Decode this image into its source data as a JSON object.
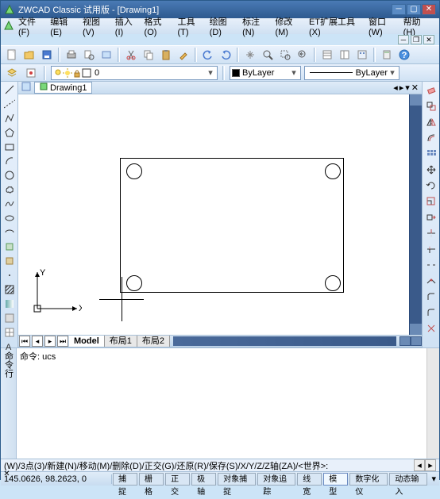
{
  "title": "ZWCAD Classic 试用版 - [Drawing1]",
  "menus": [
    "文件(F)",
    "编辑(E)",
    "视图(V)",
    "插入(I)",
    "格式(O)",
    "工具(T)",
    "绘图(D)",
    "标注(N)",
    "修改(M)",
    "ET扩展工具(X)",
    "窗口(W)",
    "帮助(H)"
  ],
  "doc_tab": "Drawing1",
  "layer_name": "0",
  "property": {
    "color_text": "ByLayer",
    "linetype_text": "ByLayer"
  },
  "model_tabs": {
    "active": "Model",
    "others": [
      "布局1",
      "布局2"
    ]
  },
  "cmd_line": "(W)/3点(3)/新建(N)/移动(M)/删除(D)/正交(G)/还原(R)/保存(S)/X/Y/Z/Z轴(ZA)/<世界>:",
  "cmd_hist": "命令: ucs",
  "cmd_gutter": "命令行",
  "status": {
    "coords": "145.0626,  98.2623,  0",
    "buttons": [
      "捕捉",
      "栅格",
      "正交",
      "极轴",
      "对象捕捉",
      "对象追踪",
      "线宽",
      "模型",
      "数字化仪",
      "动态输入"
    ],
    "active_idx": 7
  }
}
